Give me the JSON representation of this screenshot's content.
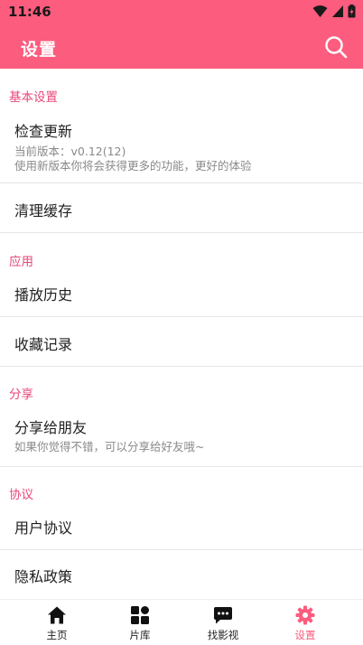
{
  "status_bar": {
    "time": "11:46"
  },
  "app_bar": {
    "title": "设置",
    "search_icon": "search-icon"
  },
  "sections": {
    "basic": {
      "header": "基本设置",
      "check_update": {
        "label": "检查更新",
        "version": "当前版本：v0.12(12)",
        "desc": "使用新版本你将会获得更多的功能，更好的体验"
      },
      "clear_cache": {
        "label": "清理缓存"
      }
    },
    "app": {
      "header": "应用",
      "history": {
        "label": "播放历史"
      },
      "favorites": {
        "label": "收藏记录"
      }
    },
    "share": {
      "header": "分享",
      "share_friends": {
        "label": "分享给朋友",
        "desc": "如果你觉得不错，可以分享给好友哦~"
      }
    },
    "agreement": {
      "header": "协议",
      "user_agreement": {
        "label": "用户协议"
      },
      "privacy": {
        "label": "隐私政策"
      }
    }
  },
  "bottom_nav": {
    "home": {
      "label": "主页",
      "icon": "home-icon"
    },
    "library": {
      "label": "片库",
      "icon": "grid-icon"
    },
    "find": {
      "label": "找影视",
      "icon": "chat-bubble-icon"
    },
    "settings": {
      "label": "设置",
      "icon": "gear-icon"
    }
  },
  "colors": {
    "accent": "#fc5c7e",
    "section_header": "#e8487a",
    "secondary_text": "#8a8a8a"
  }
}
